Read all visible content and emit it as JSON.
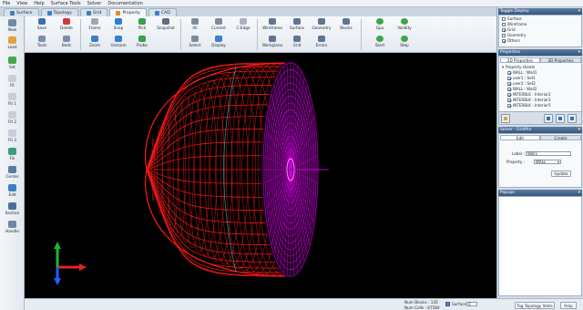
{
  "menu": [
    "File",
    "View",
    "Help",
    "Surface Tools",
    "Solver",
    "Documentation"
  ],
  "tabs": [
    {
      "label": "Surface",
      "active": false
    },
    {
      "label": "Topology",
      "active": false
    },
    {
      "label": "Grid",
      "active": false
    },
    {
      "label": "Property",
      "active": true
    },
    {
      "label": "CAD",
      "active": false
    }
  ],
  "ribbon": {
    "new": "New",
    "load": "Load",
    "save": "Save",
    "delete": "Delete",
    "tools": "Tools",
    "beds": "Beds",
    "frame": "Frame",
    "snap": "Snap",
    "zoom": "Zoom",
    "unzoom": "Unzoom",
    "pick": "Pick",
    "snapshot": "Snapshot",
    "probe": "Probe",
    "all": "All",
    "current": "Current",
    "c_edge": "C-Edge",
    "select": "Select",
    "display": "Display",
    "wireframe": "Wireframe",
    "surface": "Surface",
    "geometry": "Geometry",
    "blocks": "Blocks",
    "workplane": "Workplane",
    "grid": "Grid",
    "errors": "Errors",
    "gpu": "Gpu",
    "validity": "Validity",
    "start": "Start",
    "step": "Step"
  },
  "left_tools": [
    "Set",
    "Fit",
    "Fit 1",
    "Fit 2",
    "Fit 3",
    "Fix",
    "Center",
    "Edit",
    "Section",
    "Handle"
  ],
  "right_panel": {
    "toggle_title": "Toggle Display",
    "toggles": [
      {
        "label": "Surface",
        "checked": false
      },
      {
        "label": "Wireframe",
        "checked": false
      },
      {
        "label": "Grid",
        "checked": true
      },
      {
        "label": "Geometry",
        "checked": false
      },
      {
        "label": "Others",
        "checked": true
      }
    ],
    "properties_title": "Properties",
    "prop_tabs": [
      "2D Properties",
      "3D Properties"
    ],
    "prop_sheet_title": "Property sheets",
    "prop_items": [
      {
        "label": "WALL : Wall1",
        "checked": true
      },
      {
        "label": "user1 : Set1",
        "checked": true
      },
      {
        "label": "user2 : Set2",
        "checked": true
      },
      {
        "label": "WALL : Wall2",
        "checked": true
      },
      {
        "label": "INTERBLK : Interior2",
        "checked": true
      },
      {
        "label": "INTERBLK : Interior3",
        "checked": true
      },
      {
        "label": "INTERBLK : Interior5",
        "checked": true
      }
    ],
    "solver_title": "Solver - GridPro",
    "solver_tabs": [
      "Edit",
      "Create"
    ],
    "label_caption": "Label :",
    "label_value": "Wall1",
    "property_caption": "Property :",
    "property_value": "WALL",
    "update_label": "Update",
    "popups_title": "Popups"
  },
  "status": {
    "num_blocks_label": "Num Blocks :",
    "num_blocks": "135",
    "num_cells_label": "Num Cells :",
    "num_cells": "67584",
    "surface_id_label": "Surface id",
    "surface_id": "0",
    "tag_topology": "Tag Topology State",
    "help": "Help"
  },
  "colors": {
    "grid_red": "#ff1a1a",
    "grid_magenta": "#d100e0",
    "axis_x": "#e82020",
    "axis_y": "#1fb82a",
    "axis_z": "#2060ff"
  }
}
